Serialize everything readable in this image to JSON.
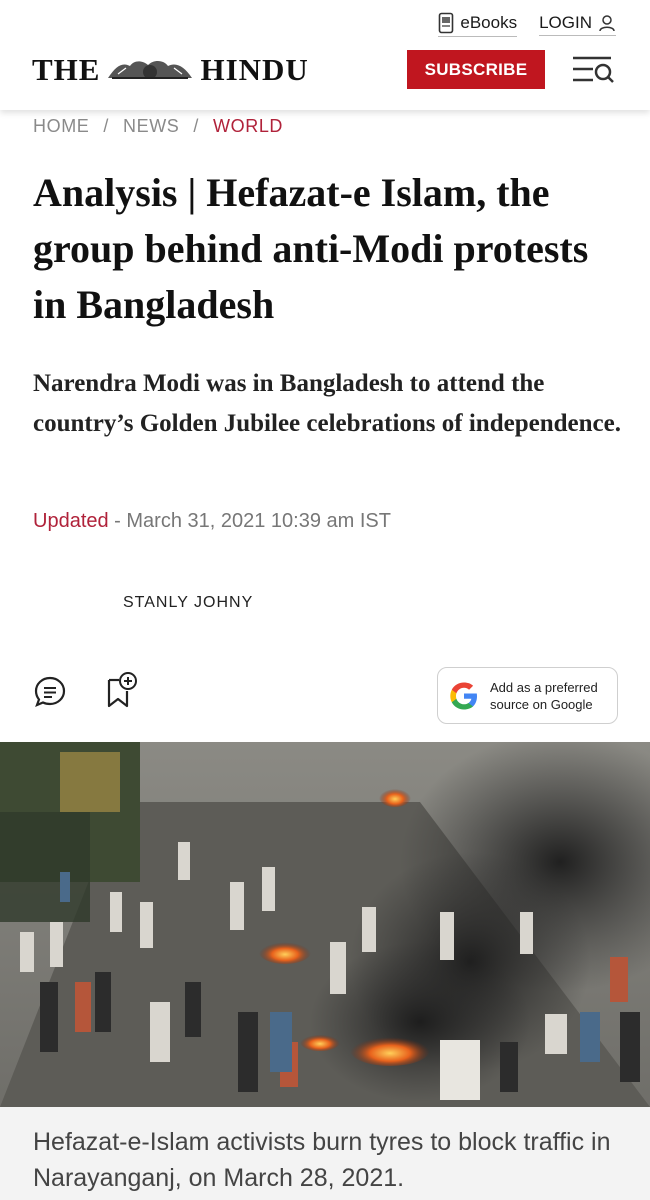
{
  "header": {
    "ebooks_label": "eBooks",
    "login_label": "LOGIN",
    "logo_left": "THE",
    "logo_right": "HINDU",
    "subscribe_label": "SUBSCRIBE"
  },
  "breadcrumb": {
    "items": [
      "HOME",
      "NEWS",
      "WORLD"
    ],
    "separator": "/"
  },
  "article": {
    "headline": "Analysis | Hefazat-e Islam, the group behind anti-Modi protests in Bangladesh",
    "summary": "Narendra Modi was in Bangladesh to attend the country’s Golden Jubilee celebrations of independence.",
    "updated_label": "Updated",
    "updated_value": " - March 31, 2021 10:39 am IST",
    "author": "STANLY JOHNY"
  },
  "actions": {
    "google_line1": "Add as a preferred",
    "google_line2": "source on Google"
  },
  "photo": {
    "caption": "Hefazat-e-Islam activists burn tyres to block traffic in Narayanganj, on March 28, 2021."
  },
  "colors": {
    "brand_red": "#c0161f",
    "breadcrumb_active": "#b0223a"
  },
  "icons": [
    "ebook-icon",
    "user-icon",
    "menu-search-icon",
    "comment-icon",
    "bookmark-add-icon",
    "google-g-icon"
  ]
}
